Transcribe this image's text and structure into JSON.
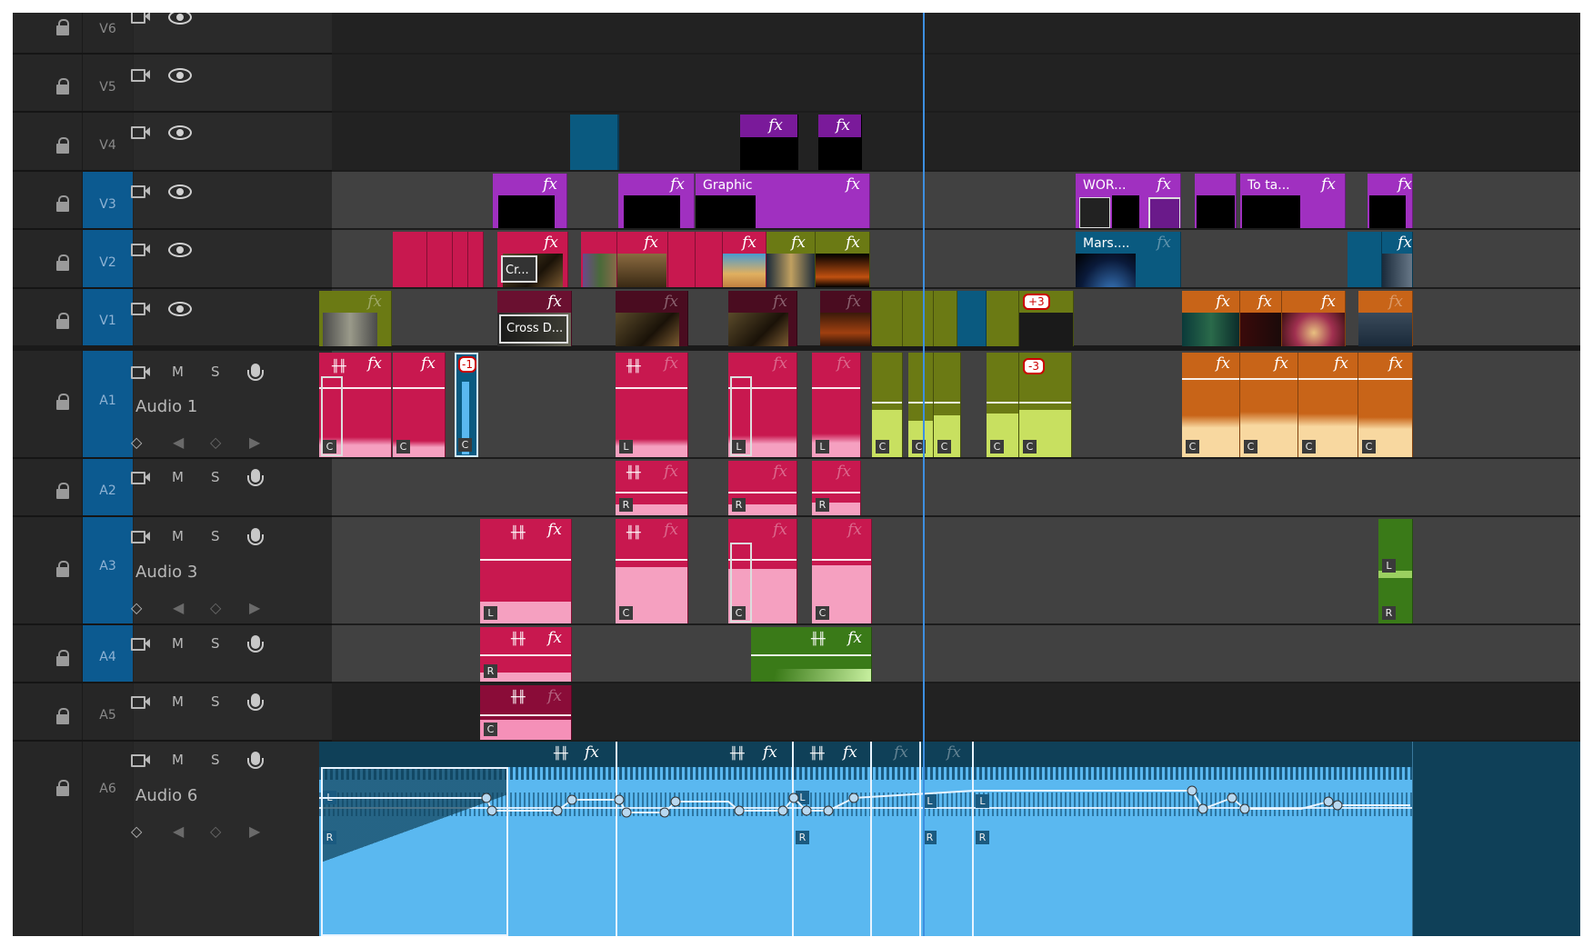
{
  "tracks": [
    {
      "id": "V6",
      "label": "V6",
      "active": false
    },
    {
      "id": "V5",
      "label": "V5",
      "active": false
    },
    {
      "id": "V4",
      "label": "V4",
      "active": false
    },
    {
      "id": "V3",
      "label": "V3",
      "active": true
    },
    {
      "id": "V2",
      "label": "V2",
      "active": true
    },
    {
      "id": "V1",
      "label": "V1",
      "active": true
    },
    {
      "id": "A1",
      "label": "A1",
      "name": "Audio 1",
      "active": true
    },
    {
      "id": "A2",
      "label": "A2",
      "active": true
    },
    {
      "id": "A3",
      "label": "A3",
      "name": "Audio 3",
      "active": true
    },
    {
      "id": "A4",
      "label": "A4",
      "active": true
    },
    {
      "id": "A5",
      "label": "A5",
      "active": false
    },
    {
      "id": "A6",
      "label": "A6",
      "name": "Audio 6",
      "active": false
    }
  ],
  "buttons": {
    "mute": "M",
    "solo": "S"
  },
  "clip_labels": {
    "graphic": "Graphic",
    "wor": "WOR...",
    "to_ta": "To ta...",
    "mars": "Mars....",
    "cr": "Cr...",
    "cross_d": "Cross D...",
    "fx": "fx"
  },
  "badges": {
    "plus3": "+3",
    "minus1": "-1",
    "minus3": "-3"
  },
  "channel_tags": {
    "c": "C",
    "l": "L",
    "r": "R"
  },
  "colors": {
    "pink": "#c8184f",
    "magenta": "#a030c0",
    "olive": "#6b7a14",
    "lime": "#c8e060",
    "orange": "#c86418",
    "teal": "#0a5a80",
    "green": "#3a7a18",
    "cyan": "#5ab8f0",
    "playhead": "#3d8fe0"
  },
  "icons": [
    "lock-icon",
    "film-icon",
    "eye-icon",
    "mic-icon",
    "keyframe-icon",
    "fx-icon",
    "waveform-icon"
  ]
}
